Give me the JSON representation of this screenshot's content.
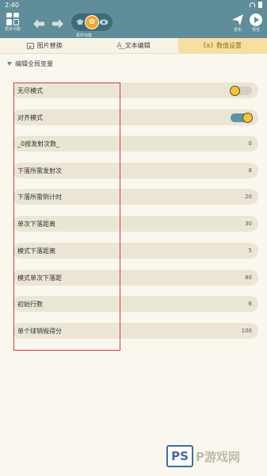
{
  "status_bar": {
    "time": "2:40"
  },
  "toolbar": {
    "more_label": "更多功能",
    "center_label": "素材功能",
    "publish_label": "发布",
    "play_label": "预览"
  },
  "tabs": [
    {
      "label": "图片替换",
      "icon": "image-icon",
      "active": false
    },
    {
      "label": "文本编辑",
      "icon": "text-icon",
      "active": false
    },
    {
      "label": "数值设置",
      "icon": "variable-icon",
      "glyph": "(x)",
      "active": true
    }
  ],
  "section": {
    "title": "编辑全局变量"
  },
  "rows": [
    {
      "label": "无尽模式",
      "type": "toggle",
      "toggle_on": false
    },
    {
      "label": "对齐模式",
      "type": "toggle",
      "toggle_on": true
    },
    {
      "label": "_0按发射次数_",
      "type": "value",
      "value": "0"
    },
    {
      "label": "下落所需发射次",
      "type": "value",
      "value": "8"
    },
    {
      "label": "下落所需倒计时",
      "type": "value",
      "value": "20"
    },
    {
      "label": "单次下落距离",
      "type": "value",
      "value": "30"
    },
    {
      "label": "模式下落距离",
      "type": "value",
      "value": "5"
    },
    {
      "label": "模式单次下落距",
      "type": "value",
      "value": "80"
    },
    {
      "label": "初始行数",
      "type": "value",
      "value": "6"
    },
    {
      "label": "单个球销毁得分",
      "type": "value",
      "value": "100"
    }
  ],
  "colors": {
    "toolbar": "#5f8d99",
    "active_tab": "#f6dfa0",
    "toggle_on": "#5c93a8",
    "knob": "#f7c331",
    "highlight": "#d9383a"
  },
  "watermark": {
    "box_text": "PS",
    "text": "P游戏网"
  }
}
